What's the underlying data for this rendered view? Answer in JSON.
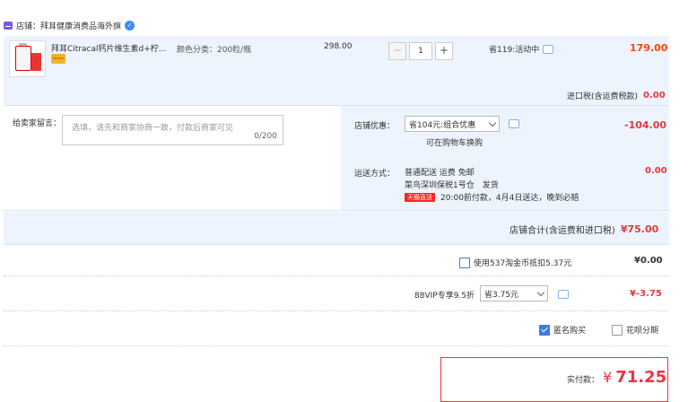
{
  "shop": {
    "label": "店铺：拜耳健康消费品海外旗",
    "badge_icon": "check-badge-icon"
  },
  "item": {
    "title": "拜耳Citracal钙片维生素d+柠...",
    "spec": "颜色分类：200粒/瓶",
    "price": "298.00",
    "qty_minus": "−",
    "qty": "1",
    "qty_plus": "+",
    "promo": "省119:活动中",
    "total": "179.00"
  },
  "import_tax": {
    "label": "进口税(含运费税款)",
    "value": "0.00"
  },
  "message": {
    "label": "给卖家留言：",
    "placeholder": "选填，请先和商家协商一致，付款后商家可见",
    "count": "0/200"
  },
  "discount": {
    "label": "店铺优惠：",
    "selected": "省104元:组合优惠",
    "note": "可在购物车换购",
    "value": "-104.00"
  },
  "shipping": {
    "label": "运送方式：",
    "line1": "普通配送 运费 免邮",
    "line2": "菜鸟深圳保税1号仓　发货",
    "tmall": "天猫直送",
    "eta": "20:00前付款，4月4日送达，晚到必赔",
    "value": "0.00"
  },
  "subtotal": {
    "label": "店铺合计(含运费和进口税)",
    "value": "¥75.00"
  },
  "coins": {
    "label": "使用537淘金币抵扣5.37元",
    "value": "¥0.00",
    "checked": false
  },
  "vip": {
    "label": "88VIP专享9.5折",
    "selected": "省3.75元",
    "value": "¥-3.75"
  },
  "options": {
    "anonymous": "匿名购买",
    "installment": "花呗分期"
  },
  "pay": {
    "label": "实付款：",
    "currency": "¥",
    "amount": "71.25"
  },
  "colors": {
    "accent": "#f40",
    "panel": "#eef4fd",
    "red": "#e4393c"
  }
}
